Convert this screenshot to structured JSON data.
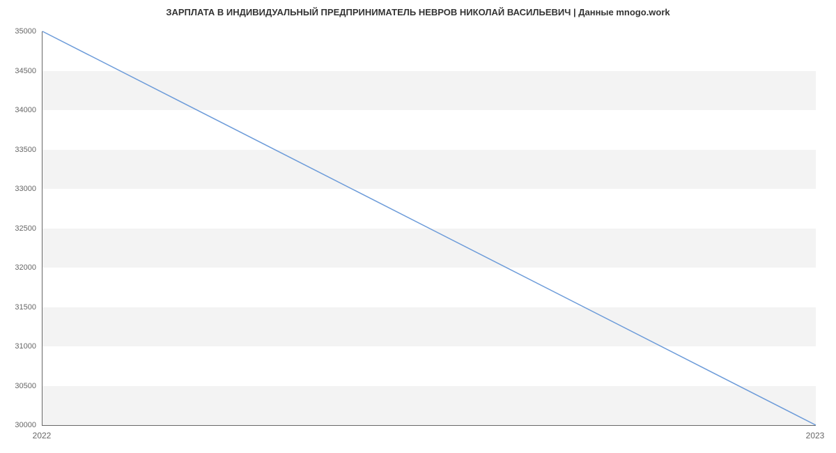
{
  "chart_data": {
    "type": "line",
    "title": "ЗАРПЛАТА В ИНДИВИДУАЛЬНЫЙ ПРЕДПРИНИМАТЕЛЬ НЕВРОВ НИКОЛАЙ ВАСИЛЬЕВИЧ | Данные mnogo.work",
    "categories": [
      "2022",
      "2023"
    ],
    "values": [
      35000,
      30000
    ],
    "xlabel": "",
    "ylabel": "",
    "ylim": [
      30000,
      35000
    ],
    "y_ticks": [
      30000,
      30500,
      31000,
      31500,
      32000,
      32500,
      33000,
      33500,
      34000,
      34500,
      35000
    ],
    "line_color": "#6c9bd9",
    "grid_band_color": "#f3f3f3"
  }
}
